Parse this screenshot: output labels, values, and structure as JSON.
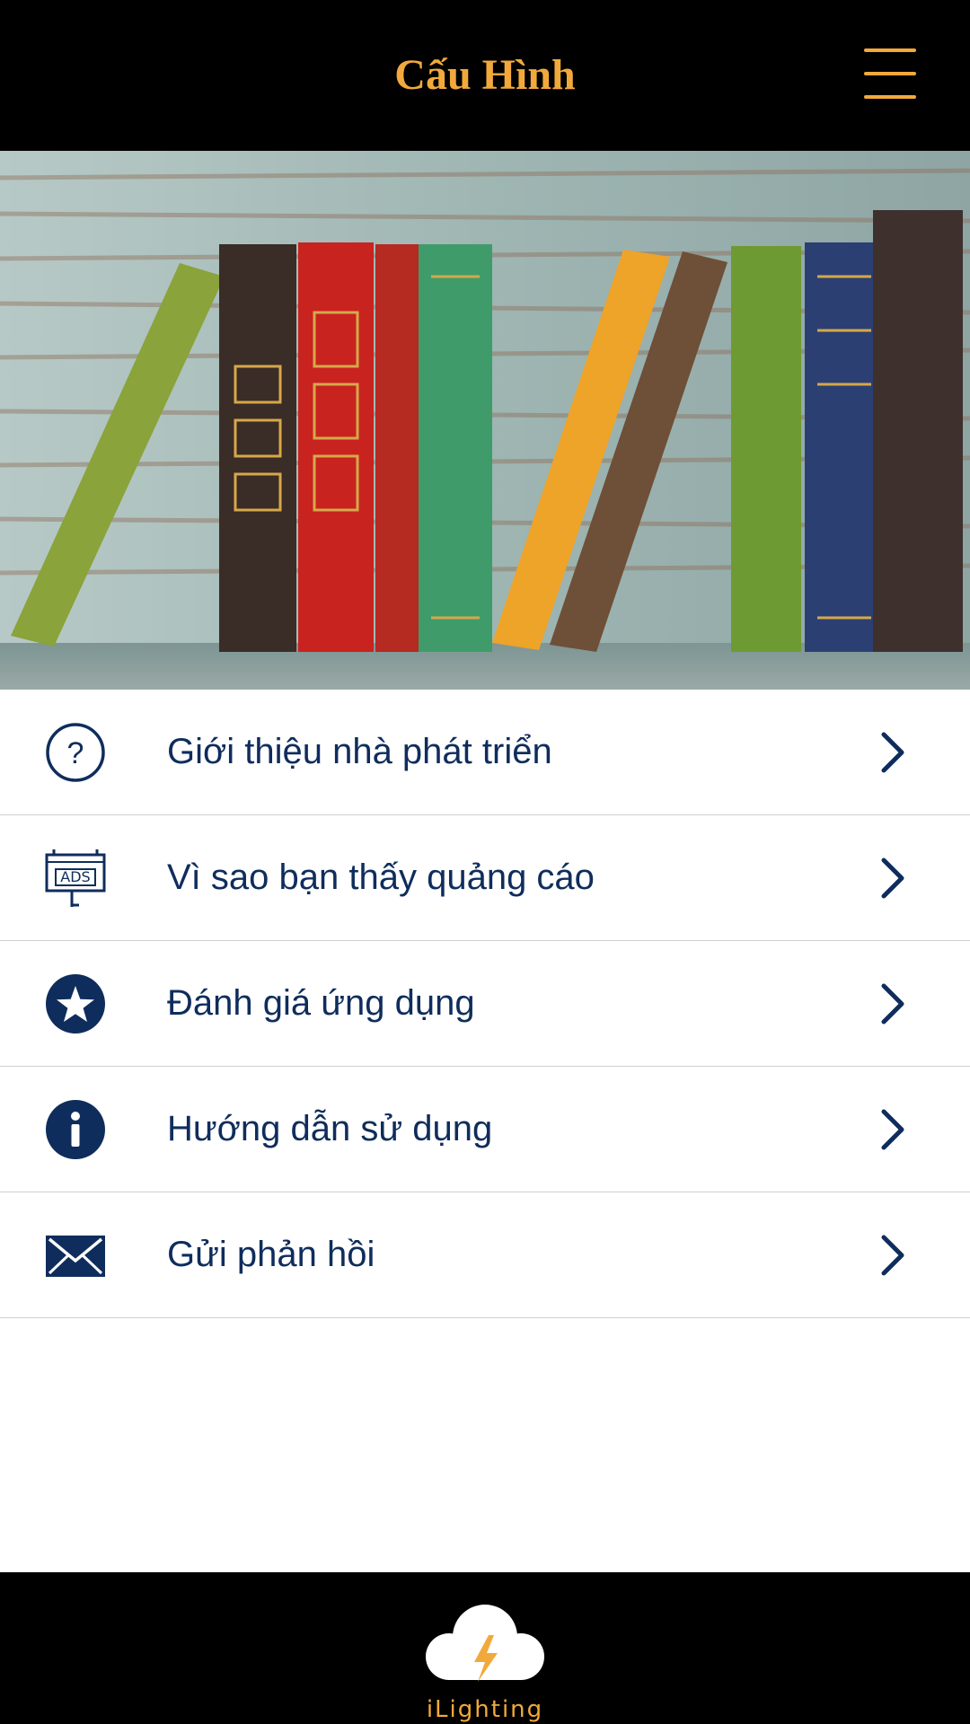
{
  "header": {
    "title": "Cấu Hình",
    "menu_icon": "hamburger-menu-icon"
  },
  "hero": {
    "description_icon": "bookshelf-image"
  },
  "menu": {
    "items": [
      {
        "label": "Giới thiệu nhà phát triển",
        "icon": "question-circle-icon"
      },
      {
        "label": "Vì sao bạn thấy quảng cáo",
        "icon": "ads-billboard-icon"
      },
      {
        "label": "Đánh giá ứng dụng",
        "icon": "star-circle-icon"
      },
      {
        "label": "Hướng dẫn sử dụng",
        "icon": "info-circle-icon"
      },
      {
        "label": "Gửi phản hồi",
        "icon": "envelope-icon"
      }
    ]
  },
  "footer": {
    "logo_text": "iLighting"
  },
  "colors": {
    "accent": "#f2a93b",
    "primary_text": "#0f2d5c",
    "bar": "#000000"
  }
}
